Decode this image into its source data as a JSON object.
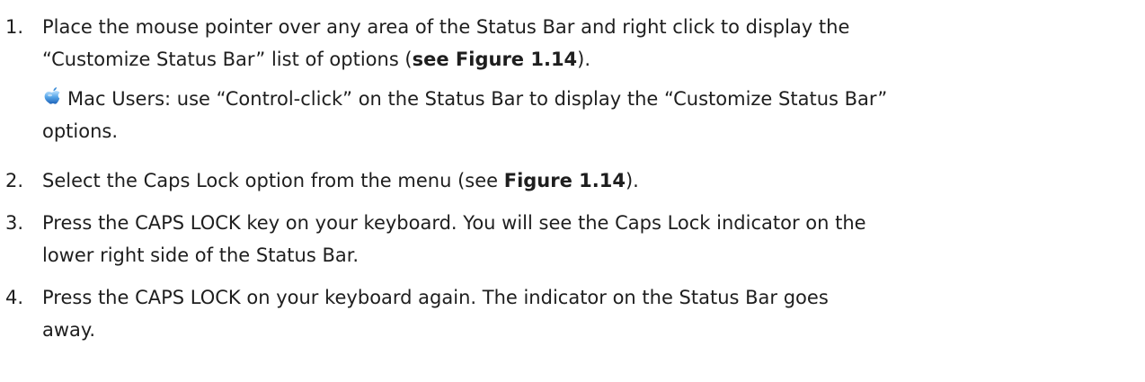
{
  "steps": [
    {
      "number": "1.",
      "line1": "Place the mouse pointer over any area of the Status Bar and right click to display the",
      "line2_pre": "“Customize Status Bar” list of options (",
      "line2_bold": "see Figure 1.14",
      "line2_post": ").",
      "mac_note": {
        "line1": "Mac Users: use “Control-click” on the Status Bar to display the “Customize Status Bar”",
        "line2": "options."
      }
    },
    {
      "number": "2.",
      "text_pre": "Select the Caps Lock option from the menu (see ",
      "text_bold": "Figure 1.14",
      "text_post": ")."
    },
    {
      "number": "3.",
      "line1": "Press the CAPS LOCK key on your keyboard. You will see the Caps Lock indicator on the",
      "line2": "lower right side of the Status Bar."
    },
    {
      "number": "4.",
      "line1": "Press the CAPS LOCK on your keyboard again. The indicator on the Status Bar goes",
      "line2": "away."
    }
  ],
  "icons": {
    "mac": "apple-logo-icon"
  }
}
